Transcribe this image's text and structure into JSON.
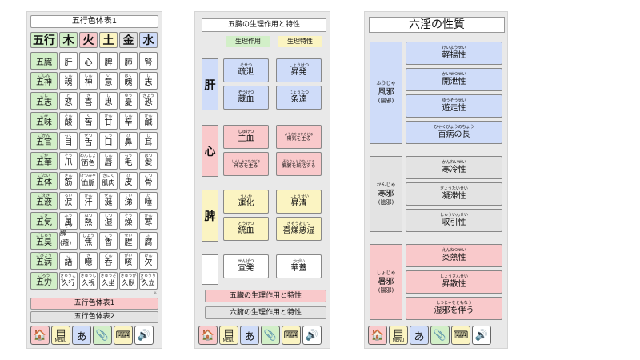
{
  "colors": {
    "blue": "#cfdcf9",
    "pink": "#f9c9cb",
    "yellow": "#fbf4c2",
    "green": "#d2efc8",
    "gray": "#e3e3e3",
    "white": "#ffffff"
  },
  "screen1": {
    "title": "五行色体表1",
    "header": [
      {
        "text": "五行",
        "color": "#d2efc8"
      },
      {
        "text": "木",
        "color": "#d2efc8"
      },
      {
        "text": "火",
        "color": "#f9c9cb"
      },
      {
        "text": "土",
        "color": "#fbf4c2"
      },
      {
        "text": "金",
        "color": "#e3e3e3"
      },
      {
        "text": "水",
        "color": "#cfdcf9"
      }
    ],
    "rows": [
      {
        "label": {
          "fu": "",
          "kj": "五臓"
        },
        "cells": [
          {
            "fu": "",
            "kj": "肝"
          },
          {
            "fu": "",
            "kj": "心"
          },
          {
            "fu": "",
            "kj": "脾"
          },
          {
            "fu": "",
            "kj": "肺"
          },
          {
            "fu": "",
            "kj": "腎"
          }
        ]
      },
      {
        "label": {
          "fu": "ごしん",
          "kj": "五神"
        },
        "cells": [
          {
            "fu": "こん",
            "kj": "魂"
          },
          {
            "fu": "しん",
            "kj": "神"
          },
          {
            "fu": "い",
            "kj": "意"
          },
          {
            "fu": "はく",
            "kj": "魄"
          },
          {
            "fu": "し",
            "kj": "志"
          }
        ]
      },
      {
        "label": {
          "fu": "ごし",
          "kj": "五志"
        },
        "cells": [
          {
            "fu": "ど",
            "kj": "怒"
          },
          {
            "fu": "き",
            "kj": "喜"
          },
          {
            "fu": "し",
            "kj": "思"
          },
          {
            "fu": "ゆう",
            "kj": "憂"
          },
          {
            "fu": "きょう",
            "kj": "恐"
          }
        ]
      },
      {
        "label": {
          "fu": "ごみ",
          "kj": "五味"
        },
        "cells": [
          {
            "fu": "さん",
            "kj": "酸"
          },
          {
            "fu": "く",
            "kj": "苦"
          },
          {
            "fu": "かん",
            "kj": "甘"
          },
          {
            "fu": "しん",
            "kj": "辛"
          },
          {
            "fu": "かん",
            "kj": "鹹"
          }
        ]
      },
      {
        "label": {
          "fu": "ごかん",
          "kj": "五官"
        },
        "cells": [
          {
            "fu": "もく",
            "kj": "目"
          },
          {
            "fu": "ぜつ",
            "kj": "舌"
          },
          {
            "fu": "こう",
            "kj": "口"
          },
          {
            "fu": "び",
            "kj": "鼻"
          },
          {
            "fu": "じ",
            "kj": "耳"
          }
        ]
      },
      {
        "label": {
          "fu": "ごか",
          "kj": "五華"
        },
        "cells": [
          {
            "fu": "そう",
            "kj": "爪"
          },
          {
            "fu": "めんしょく",
            "kj": "面色",
            "small": true
          },
          {
            "fu": "しん",
            "kj": "唇"
          },
          {
            "fu": "もう",
            "kj": "毛"
          },
          {
            "fu": "はつ",
            "kj": "髪"
          }
        ]
      },
      {
        "label": {
          "fu": "ごたい",
          "kj": "五体"
        },
        "cells": [
          {
            "fu": "きん",
            "kj": "筋"
          },
          {
            "fu": "けつみゃく",
            "kj": "血脈",
            "small": true
          },
          {
            "fu": "きにく",
            "kj": "肌肉",
            "small": true
          },
          {
            "fu": "ひ",
            "kj": "皮"
          },
          {
            "fu": "こつ",
            "kj": "骨"
          }
        ]
      },
      {
        "label": {
          "fu": "ごえき",
          "kj": "五液"
        },
        "cells": [
          {
            "fu": "るい",
            "kj": "涙"
          },
          {
            "fu": "かん",
            "kj": "汗"
          },
          {
            "fu": "ぜん",
            "kj": "涎"
          },
          {
            "fu": "てい",
            "kj": "涕"
          },
          {
            "fu": "だ",
            "kj": "唾"
          }
        ]
      },
      {
        "label": {
          "fu": "ごき",
          "kj": "五気"
        },
        "cells": [
          {
            "fu": "ふう",
            "kj": "風"
          },
          {
            "fu": "ねつ",
            "kj": "熱"
          },
          {
            "fu": "しつ",
            "kj": "湿"
          },
          {
            "fu": "そう",
            "kj": "燥"
          },
          {
            "fu": "かん",
            "kj": "寒"
          }
        ]
      },
      {
        "label": {
          "fu": "ごしゅう",
          "kj": "五臭"
        },
        "cells": [
          {
            "fu": "そう",
            "kj": "臊(羶)",
            "small": true
          },
          {
            "fu": "しょう",
            "kj": "焦"
          },
          {
            "fu": "こう",
            "kj": "香"
          },
          {
            "fu": "せい",
            "kj": "腥"
          },
          {
            "fu": "ふ",
            "kj": "腐"
          }
        ]
      },
      {
        "label": {
          "fu": "ごびょう",
          "kj": "五病"
        },
        "cells": [
          {
            "fu": "ご",
            "kj": "語"
          },
          {
            "fu": "き",
            "kj": "噫"
          },
          {
            "fu": "どん",
            "kj": "呑"
          },
          {
            "fu": "がい",
            "kj": "咳"
          },
          {
            "fu": "けん",
            "kj": "欠"
          }
        ]
      },
      {
        "label": {
          "fu": "ごろう",
          "kj": "五労"
        },
        "cells": [
          {
            "fu": "きゅうこう",
            "kj": "久行",
            "small": true
          },
          {
            "fu": "きゅうし",
            "kj": "久視",
            "small": true
          },
          {
            "fu": "きゅうざ",
            "kj": "久坐",
            "small": true
          },
          {
            "fu": "きゅうが",
            "kj": "久臥",
            "small": true
          },
          {
            "fu": "きゅうりつ",
            "kj": "久立",
            "small": true
          }
        ]
      }
    ],
    "note": "※",
    "btn1": "五行色体表1",
    "btn2": "五行色体表2"
  },
  "toolbar": {
    "home": "🏠",
    "menu_label": "MENU",
    "menu_icon": "▤",
    "kana": "あ",
    "clip": "📎",
    "keyboard": "⌨",
    "sound": "🔊"
  },
  "screen2": {
    "title": "五臓の生理作用と特性",
    "legend_action": "生理作用",
    "legend_trait": "生理特性",
    "organs": [
      {
        "name": "肝",
        "left": [
          {
            "fu": "そせつ",
            "kj": "疏泄"
          },
          {
            "fu": "ぞうけつ",
            "kj": "蔵血"
          }
        ],
        "right": [
          {
            "fu": "しょうはつ",
            "kj": "昇発"
          },
          {
            "fu": "じょうたつ",
            "kj": "条達"
          }
        ]
      },
      {
        "name": "心",
        "left": [
          {
            "fu": "しゅけつ",
            "kj": "主血"
          },
          {
            "fu": "しんしをつかさどる",
            "kj": "神志を主る",
            "sm": true
          }
        ],
        "right": [
          {
            "fu": "ようきをつかさどる",
            "kj": "陽気を主る",
            "sm": true
          },
          {
            "fu": "そうなんとうかいする",
            "kj": "臓腑を統括する",
            "sm": true
          }
        ]
      },
      {
        "name": "脾",
        "left": [
          {
            "fu": "うんか",
            "kj": "運化"
          },
          {
            "fu": "とうけつ",
            "kj": "統血"
          }
        ],
        "right": [
          {
            "fu": "しょうせい",
            "kj": "昇清"
          },
          {
            "fu": "きそうおしつ",
            "kj": "喜燥悪湿"
          }
        ]
      },
      {
        "name": "",
        "left": [
          {
            "fu": "せんぱつ",
            "kj": "宣発"
          },
          {
            "fu": "",
            "kj": ""
          }
        ],
        "right": [
          {
            "fu": "かがい",
            "kj": "華蓋"
          },
          {
            "fu": "",
            "kj": ""
          }
        ]
      }
    ],
    "btn_active": "五臓の生理作用と特性",
    "btn_other": "六腑の生理作用と特性"
  },
  "screen3": {
    "title": "六淫の性質",
    "groups": [
      {
        "fu": "ふうじゃ",
        "kj": "風邪",
        "sub": "(陽邪)",
        "props": [
          {
            "fu": "けいようせい",
            "kj": "軽揚性"
          },
          {
            "fu": "かいせつせい",
            "kj": "開泄性"
          },
          {
            "fu": "ゆうそうせい",
            "kj": "遊走性"
          },
          {
            "fu": "ひゃくびょうのちょう",
            "kj": "百病の長"
          }
        ]
      },
      {
        "fu": "かんじゃ",
        "kj": "寒邪",
        "sub": "(陰邪)",
        "props": [
          {
            "fu": "かんれいせい",
            "kj": "寒冷性"
          },
          {
            "fu": "ぎょうたいせい",
            "kj": "凝滞性"
          },
          {
            "fu": "しゅういんせい",
            "kj": "収引性"
          }
        ]
      },
      {
        "fu": "しょじゃ",
        "kj": "暑邪",
        "sub": "(陽邪)",
        "props": [
          {
            "fu": "えんねつせい",
            "kj": "炎熱性"
          },
          {
            "fu": "しょうさんせい",
            "kj": "昇散性"
          },
          {
            "fu": "しつじゃをともなう",
            "kj": "湿邪を伴う"
          }
        ]
      }
    ]
  }
}
